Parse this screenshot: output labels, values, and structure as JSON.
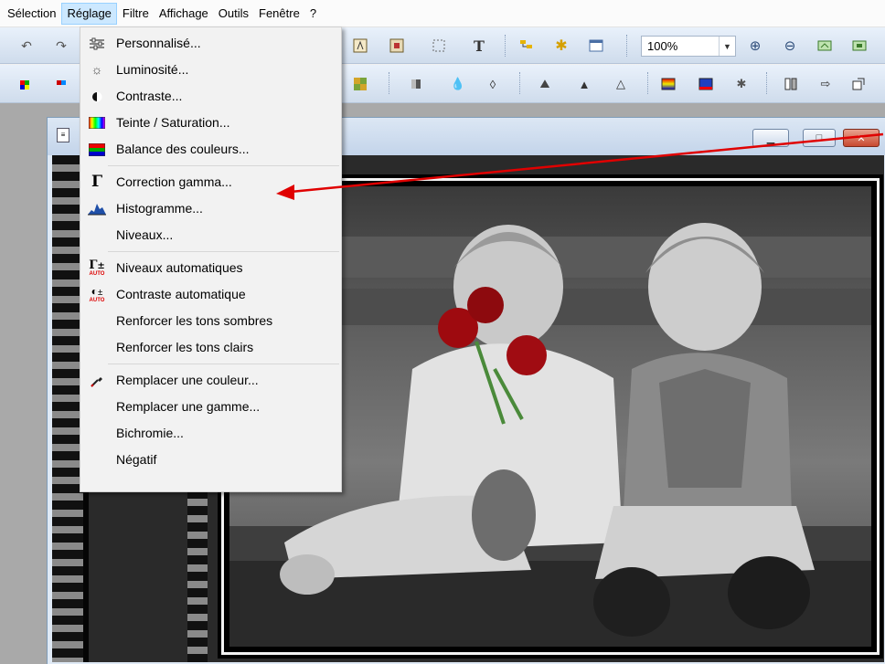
{
  "menubar": {
    "items": [
      "Sélection",
      "Réglage",
      "Filtre",
      "Affichage",
      "Outils",
      "Fenêtre",
      "?"
    ],
    "active_index": 1
  },
  "toolbar": {
    "zoom_value": "100%"
  },
  "reglage_menu": {
    "groups": [
      [
        {
          "label": "Personnalisé...",
          "icon": "sliders-icon"
        },
        {
          "label": "Luminosité...",
          "icon": "sun-icon"
        },
        {
          "label": "Contraste...",
          "icon": "contrast-icon"
        },
        {
          "label": "Teinte / Saturation...",
          "icon": "hue-gradient-icon"
        },
        {
          "label": "Balance des couleurs...",
          "icon": "color-balance-icon"
        }
      ],
      [
        {
          "label": "Correction gamma...",
          "icon": "gamma-icon"
        },
        {
          "label": "Histogramme...",
          "icon": "histogram-icon"
        },
        {
          "label": "Niveaux...",
          "icon": ""
        }
      ],
      [
        {
          "label": "Niveaux automatiques",
          "icon": "auto-levels-icon"
        },
        {
          "label": "Contraste automatique",
          "icon": "auto-contrast-icon"
        },
        {
          "label": "Renforcer les tons sombres",
          "icon": ""
        },
        {
          "label": "Renforcer les tons clairs",
          "icon": ""
        }
      ],
      [
        {
          "label": "Remplacer une couleur...",
          "icon": "eyedropper-icon"
        },
        {
          "label": "Remplacer une gamme...",
          "icon": ""
        },
        {
          "label": "Bichromie...",
          "icon": ""
        },
        {
          "label": "Négatif",
          "icon": ""
        }
      ]
    ]
  },
  "icons": {
    "gamma_glyph": "Γ",
    "auto_badge": "AUTO",
    "plus_minus": "±"
  },
  "colors": {
    "menu_highlight": "#cce8ff",
    "annotation_arrow": "#e00000",
    "rose_red": "#9e0a0f"
  }
}
